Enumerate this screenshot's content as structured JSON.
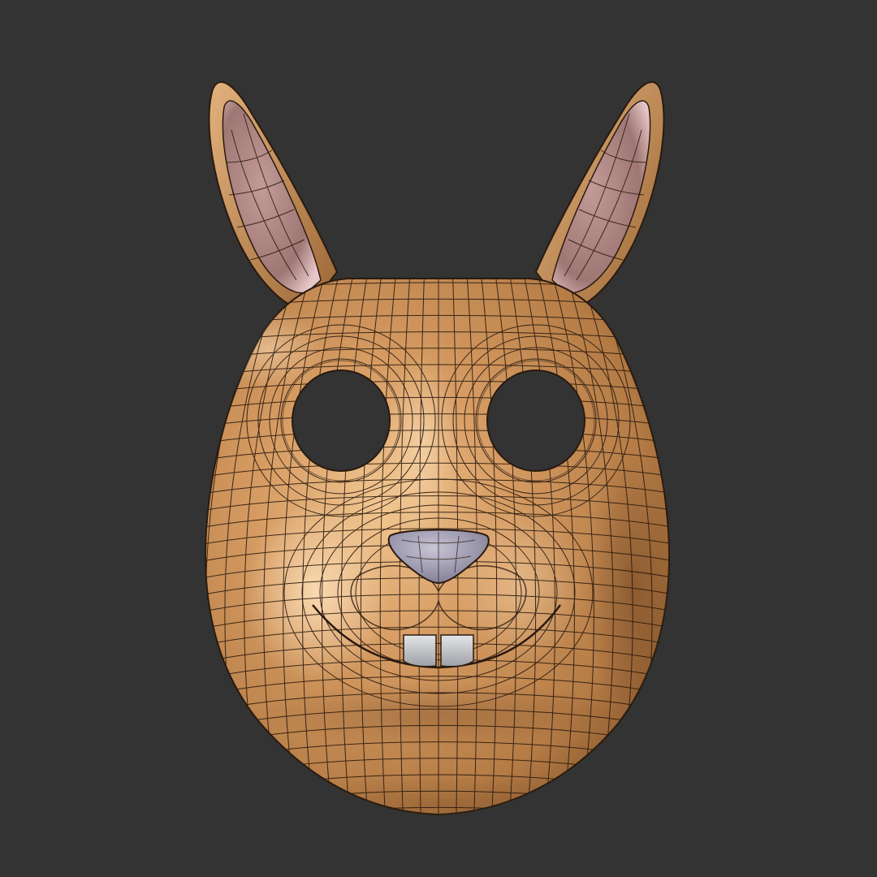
{
  "scene": {
    "subject": "rabbit-mask-3d-model",
    "render_mode": "wireframe-on-shaded"
  },
  "colors": {
    "background": "#333333",
    "mask_base": "#C88E57",
    "mask_highlight": "#F4CFA0",
    "mask_shadow": "#8A5A2E",
    "inner_ear": "#B38986",
    "inner_ear_highlight": "#E9C6C7",
    "nose": "#A7A2B9",
    "teeth": "#C9CACE",
    "wire": "#2A1A0E"
  },
  "icons": {
    "mask": "rabbit-mask-icon"
  }
}
